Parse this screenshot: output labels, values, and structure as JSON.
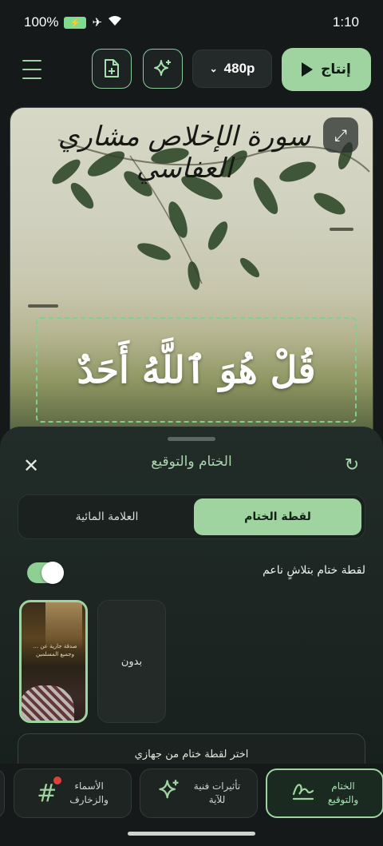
{
  "status_bar": {
    "battery": "100%",
    "time": "1:10"
  },
  "toolbar": {
    "resolution": "480p",
    "produce_label": "إنتاج"
  },
  "preview": {
    "surah_title": "سورة الإخلاص مشاري العفاسي",
    "verse_text": "قُلْ هُوَ ٱللَّهُ أَحَدٌ"
  },
  "sheet": {
    "title": "الختام والتوقيع",
    "tabs": [
      {
        "label": "لقطة الختام",
        "active": true
      },
      {
        "label": "العلامة المائية",
        "active": false
      }
    ],
    "fade_option_label": "لقطة ختام بتلاشٍ ناعم",
    "fade_option_on": true,
    "cards": {
      "selected_text": "صدقة جارية عن ... وجميع المسلمين",
      "none_label": "بدون"
    },
    "pick_button_label": "اختر لقطة ختام من جهازي"
  },
  "bottom_nav": {
    "items": [
      {
        "label": "الختام\nوالتوقيع",
        "icon": "signature-icon",
        "active": true
      },
      {
        "label": "تأثيرات فنية\nللآية",
        "icon": "sparkles-icon",
        "active": false
      },
      {
        "label": "الأسماء\nوالزخارف",
        "icon": "hashtag-icon",
        "active": false
      }
    ]
  },
  "colors": {
    "accent": "#9fd3a0",
    "background": "#15191a",
    "notification_dot": "#e0403a"
  }
}
